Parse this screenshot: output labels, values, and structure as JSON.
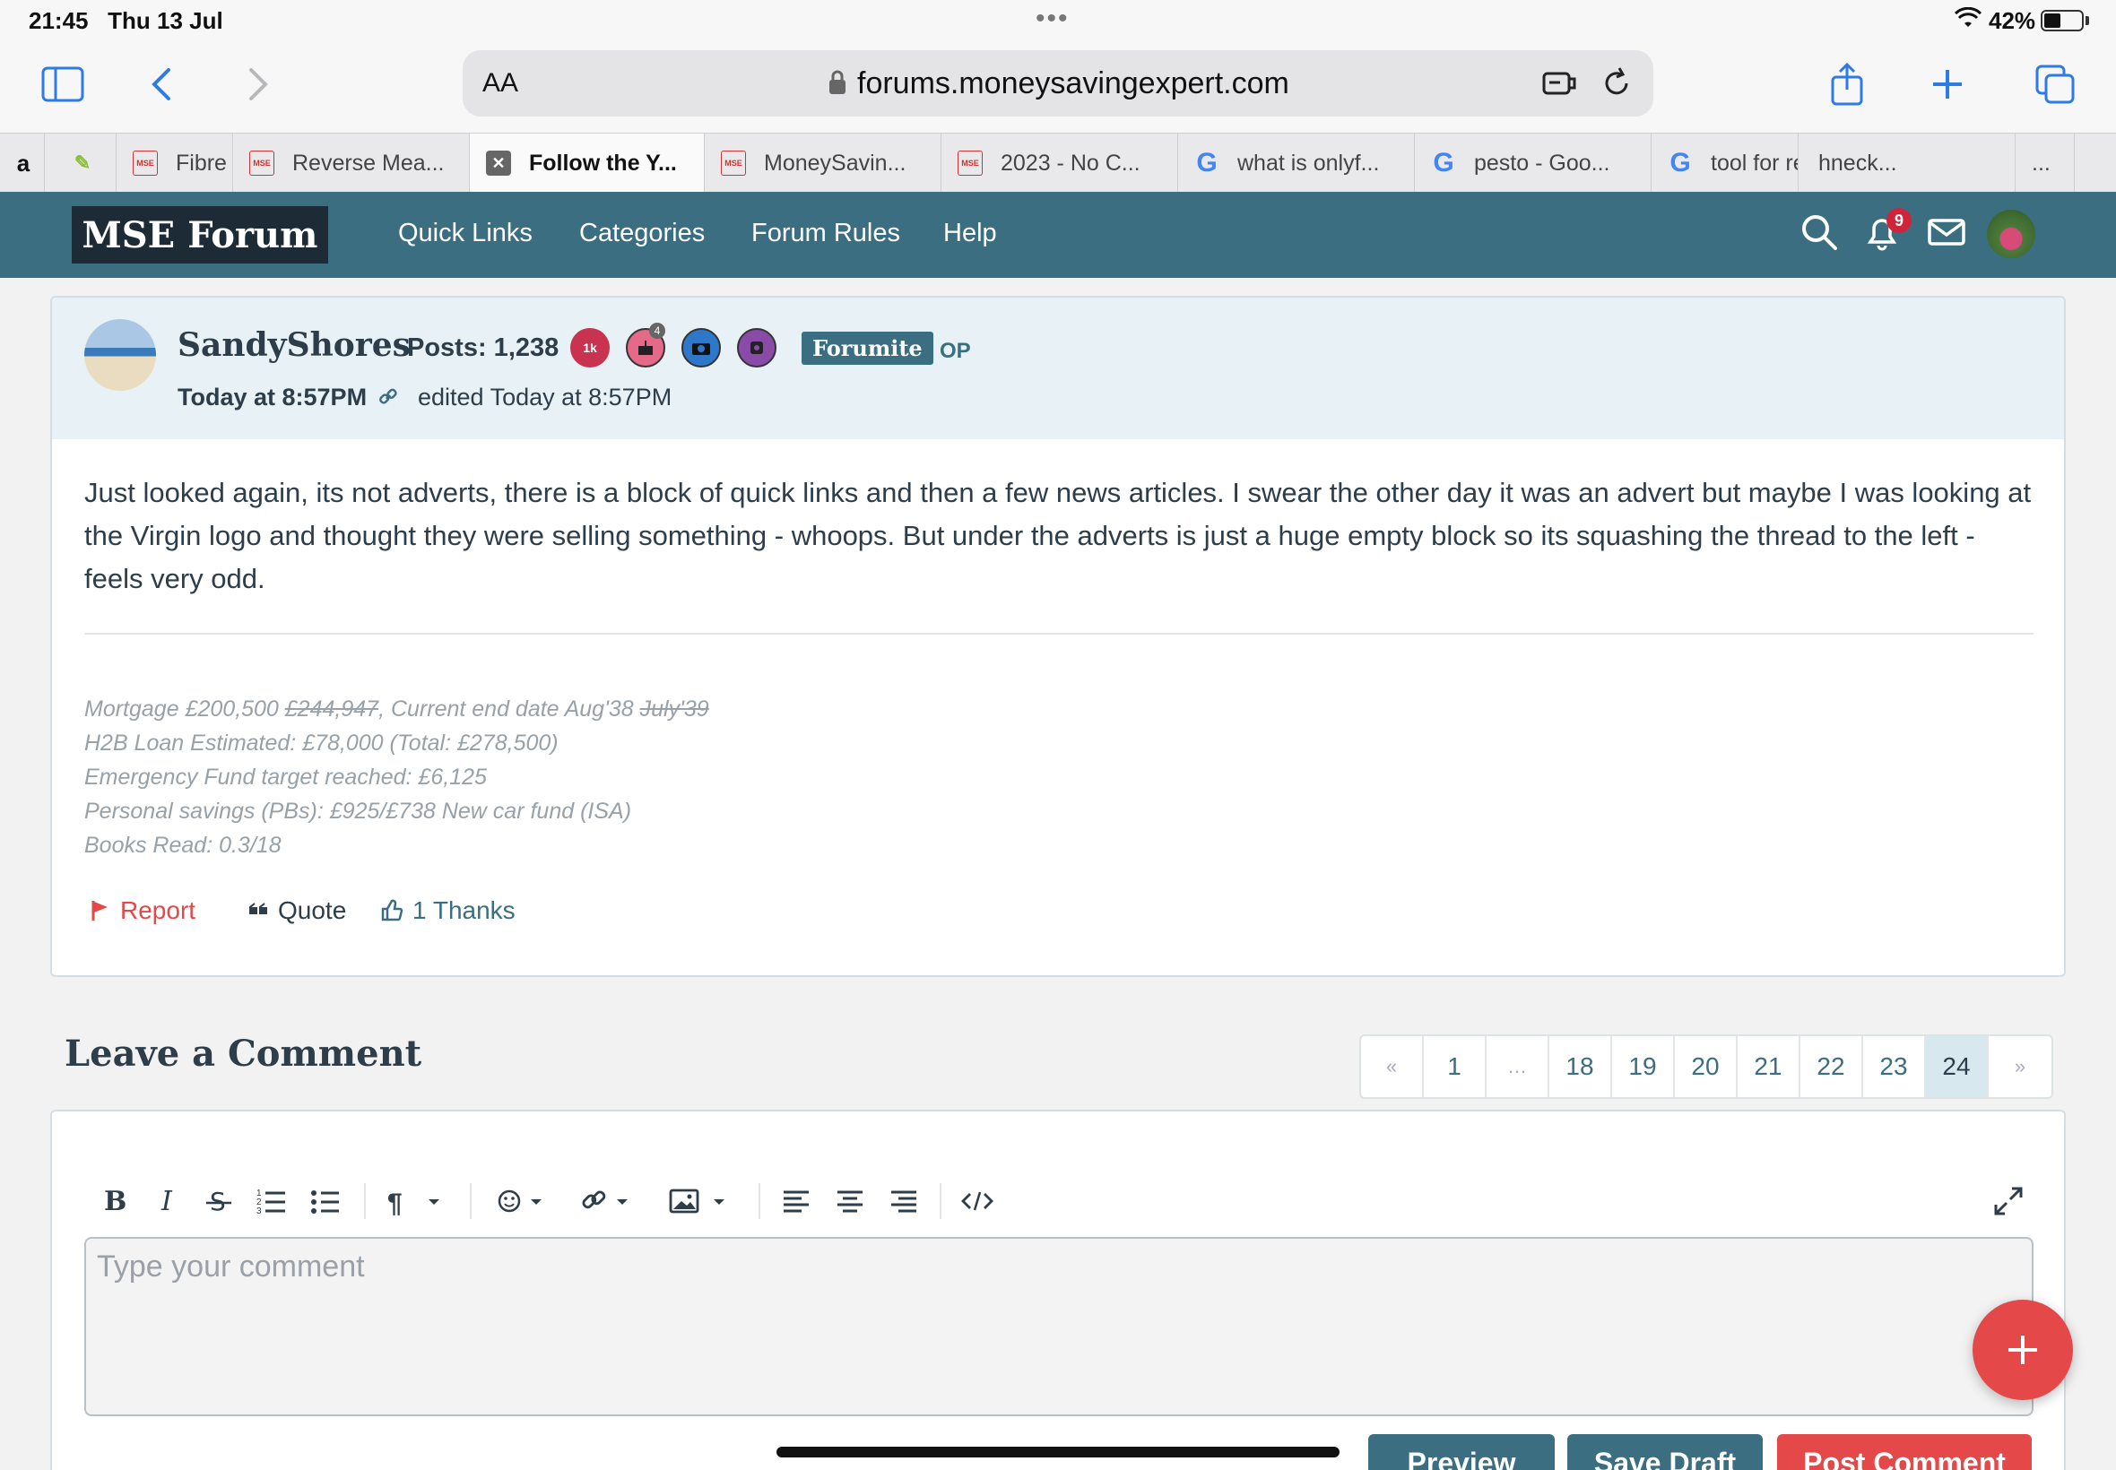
{
  "status_bar": {
    "time": "21:45",
    "date": "Thu 13 Jul",
    "battery": "42%"
  },
  "browser": {
    "address_aa": "AA",
    "url": "forums.moneysavingexpert.com",
    "tabs": [
      {
        "label": "",
        "favicon": "amazon-icon"
      },
      {
        "label": "",
        "favicon": "leaf-icon"
      },
      {
        "label": "Fibre",
        "favicon": "MSE"
      },
      {
        "label": "Reverse Mea...",
        "favicon": "MSE"
      },
      {
        "label": "Follow the Y...",
        "favicon": "close-icon",
        "active": true
      },
      {
        "label": "MoneySavin...",
        "favicon": "MSE"
      },
      {
        "label": "2023 - No C...",
        "favicon": "MSE"
      },
      {
        "label": "what is onlyf...",
        "favicon": "G"
      },
      {
        "label": "pesto - Goo...",
        "favicon": "G"
      },
      {
        "label": "tool for remo...",
        "favicon": "G"
      },
      {
        "label": "hneck...",
        "favicon": ""
      },
      {
        "label": "...",
        "favicon": ""
      }
    ]
  },
  "nav": {
    "logo": "MSE Forum",
    "links": [
      "Quick Links",
      "Categories",
      "Forum Rules",
      "Help"
    ],
    "notification_count": "9",
    "colors": {
      "nav_bg": "#3a6e80",
      "logo_bg": "#1d2b36",
      "accent_red": "#e54848"
    }
  },
  "post": {
    "author": "SandyShores",
    "posts_label": "Posts: 1,238",
    "badges": [
      "1k",
      "4",
      "camera-icon",
      "rank-icon"
    ],
    "role": "Forumite",
    "op": "OP",
    "date": "Today at 8:57PM",
    "edited": "edited Today at 8:57PM",
    "body": "Just looked again, its not adverts, there is a block of quick links and then a few news articles.  I swear the other day it was an advert but maybe I was looking at the Virgin logo and thought they were selling something - whoops.  But under the adverts is just a huge empty block so its squashing the thread to the left - feels very odd.",
    "signature": {
      "line1_a": "Mortgage £200,500 ",
      "line1_strike1": "£244,947",
      "line1_b": ", Current end date Aug'38  ",
      "line1_strike2": "July'39",
      "line2": "H2B Loan Estimated: £78,000 (Total: £278,500)",
      "line3": "Emergency Fund target reached: £6,125",
      "line4": "Personal savings (PBs): £925/£738 New car fund (ISA)",
      "line5": "Books Read: 0.3/18"
    },
    "actions": {
      "report": "Report",
      "quote": "Quote",
      "thanks": "1 Thanks"
    }
  },
  "comment": {
    "title": "Leave a Comment",
    "pagination": [
      "«",
      "1",
      "…",
      "18",
      "19",
      "20",
      "21",
      "22",
      "23",
      "24",
      "»"
    ],
    "current_page": "24",
    "placeholder": "Type your comment",
    "buttons": {
      "preview": "Preview",
      "save_draft": "Save Draft",
      "post": "Post Comment"
    }
  }
}
